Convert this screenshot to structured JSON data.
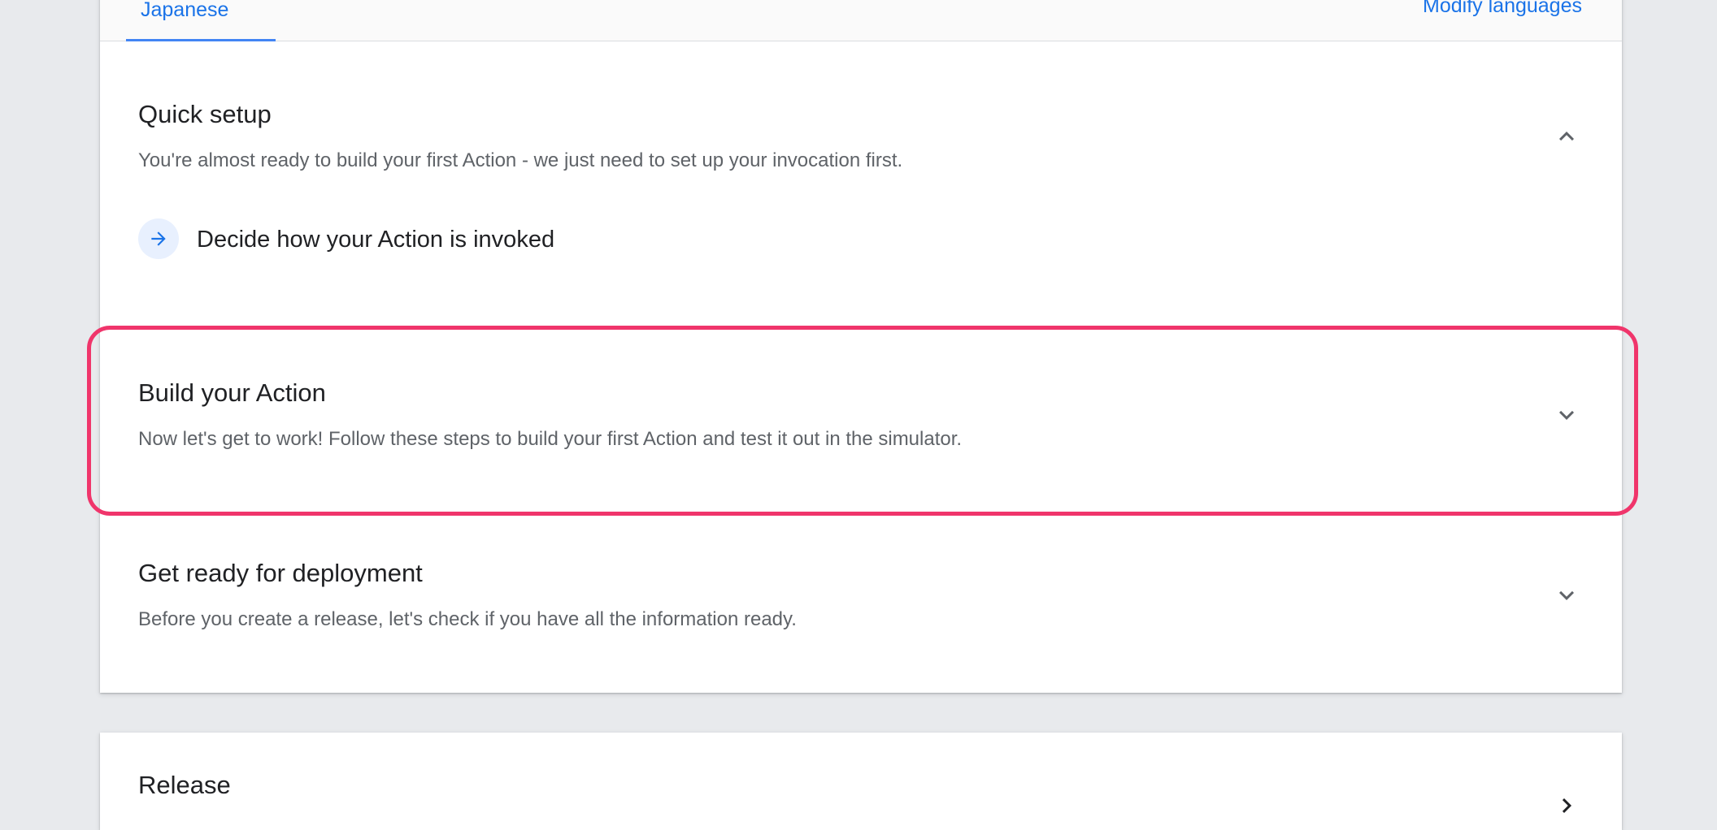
{
  "tabs": {
    "active_label": "Japanese",
    "modify_label": "Modify languages"
  },
  "sections": [
    {
      "title": "Quick setup",
      "description": "You're almost ready to build your first Action - we just need to set up your invocation first.",
      "expanded": true,
      "chevron_icon": "chevron-up-icon",
      "steps": [
        {
          "label": "Decide how your Action is invoked",
          "icon": "arrow-right-icon"
        }
      ]
    },
    {
      "title": "Build your Action",
      "description": "Now let's get to work! Follow these steps to build your first Action and test it out in the simulator.",
      "expanded": false,
      "chevron_icon": "chevron-down-icon"
    },
    {
      "title": "Get ready for deployment",
      "description": "Before you create a release, let's check if you have all the information ready.",
      "expanded": false,
      "chevron_icon": "chevron-down-icon"
    }
  ],
  "release": {
    "title": "Release",
    "chevron_icon": "chevron-right-icon"
  },
  "colors": {
    "accent": "#1a73e8",
    "tab_underline": "#4285f4",
    "highlight": "#f0356b",
    "background": "#e8eaed"
  }
}
